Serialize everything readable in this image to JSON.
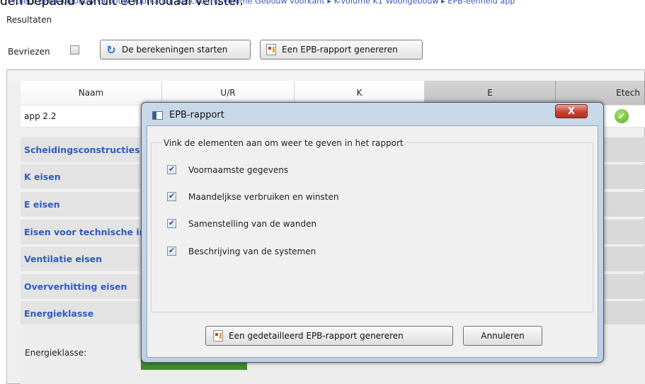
{
  "caption": "den bepaald vanuit een modaal venster.",
  "breadcrumb": "Project EPB ▸ Gebouw Gebouw voorkant ▸ Beschermd volume Gebouw voorkant ▸ K-volume K1 Woongebouw ▸ EPB-eenheid app",
  "results": {
    "title": "Resultaten",
    "freeze_label": "Bevriezen",
    "freeze_checked": false,
    "start_button": "De berekeningen starten",
    "report_button": "Een EPB-rapport genereren"
  },
  "table": {
    "headers": [
      "Naam",
      "U/R",
      "K",
      "E",
      "Etech"
    ],
    "row_name": "app 2.2",
    "sections": [
      "Scheidingsconstructies",
      "K eisen",
      "E eisen",
      "Eisen voor technische installaties",
      "Ventilatie eisen",
      "Oververhitting eisen",
      "Energieklasse"
    ],
    "energy_label": "Energieklasse:"
  },
  "dialog": {
    "title": "EPB-rapport",
    "group_title": "Vink de elementen aan om weer te geven in het rapport",
    "options": [
      {
        "label": "Voornaamste gegevens",
        "checked": true
      },
      {
        "label": "Maandeljkse verbruiken en winsten",
        "checked": true
      },
      {
        "label": "Samenstelling van de wanden",
        "checked": true
      },
      {
        "label": "Beschrijving van de systemen",
        "checked": true
      }
    ],
    "close_symbol": "X",
    "generate_button": "Een gedetailleerd EPB-rapport genereren",
    "cancel_button": "Annuleren"
  },
  "icons": {
    "refresh": "refresh-icon",
    "report": "report-icon",
    "window": "window-icon",
    "status_ok": "check-circle-icon"
  },
  "colors": {
    "section_link": "#2f5cc0",
    "close_button": "#c5422f",
    "status_ok": "#56ae22",
    "energy_bar": "#3f8a2a"
  }
}
